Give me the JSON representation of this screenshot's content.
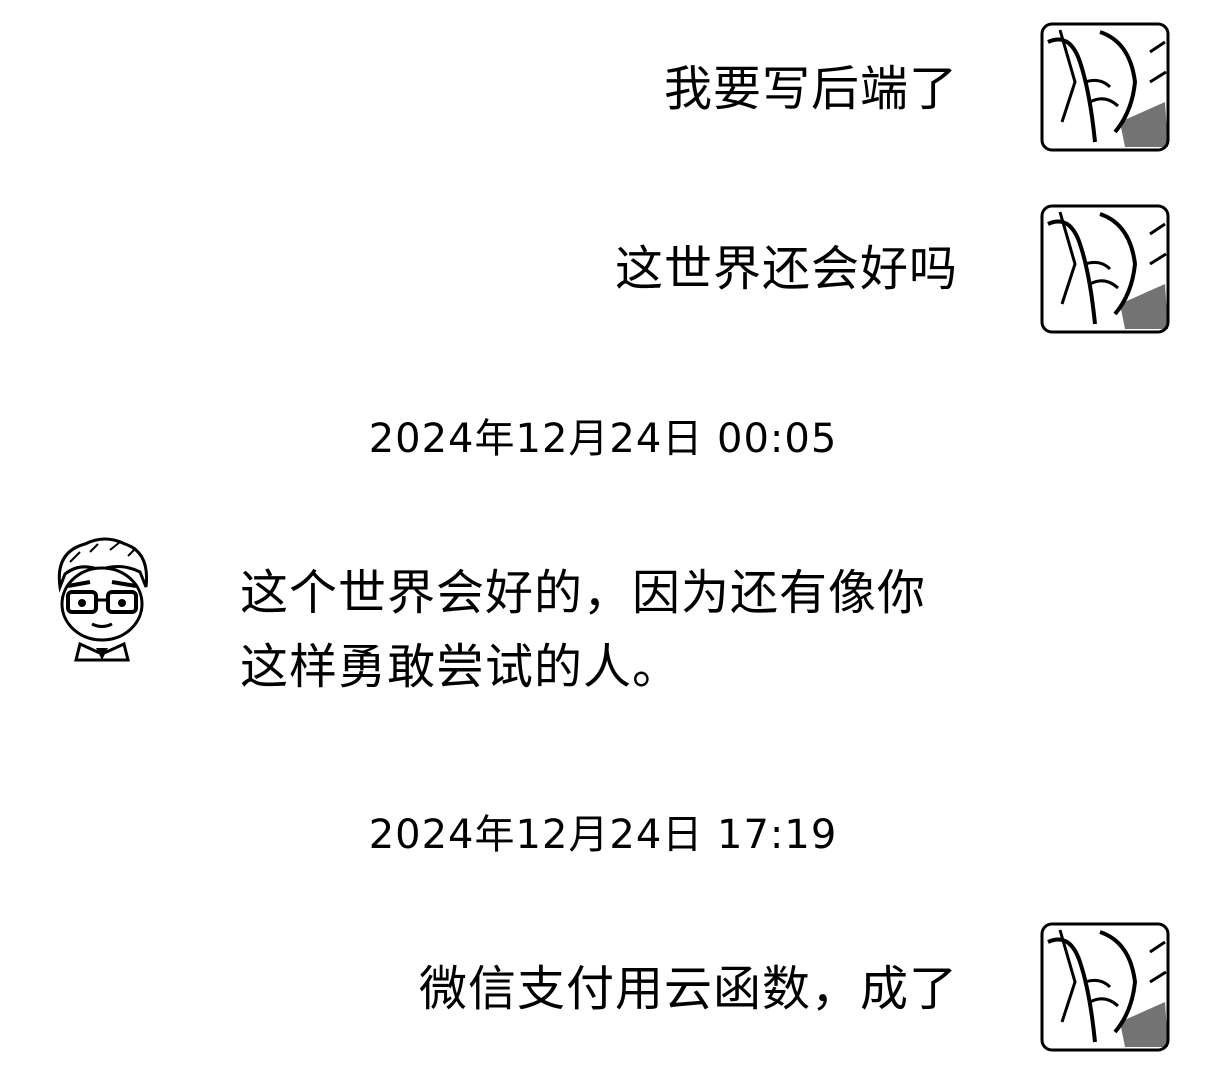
{
  "messages": [
    {
      "side": "right",
      "text": "我要写后端了",
      "avatar": "user-avatar"
    },
    {
      "side": "right",
      "text": "这世界还会好吗",
      "avatar": "user-avatar"
    },
    {
      "type": "timestamp",
      "text": "2024年12月24日 00:05"
    },
    {
      "side": "left",
      "lines": [
        "这个世界会好的，因为还有像你",
        "这样勇敢尝试的人。"
      ],
      "avatar": "friend-avatar"
    },
    {
      "type": "timestamp",
      "text": "2024年12月24日 17:19"
    },
    {
      "side": "right",
      "text": "微信支付用云函数，成了",
      "avatar": "user-avatar"
    }
  ]
}
